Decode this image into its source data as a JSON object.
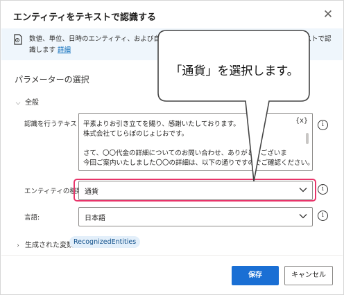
{
  "dialog": {
    "title": "エンティティをテキストで認識する",
    "close_glyph": "✕"
  },
  "info": {
    "line1": "数値、単位、日時のエンティティ、および自然言語",
    "line1_tail": "ストで認",
    "line2": "識します",
    "link": "詳細"
  },
  "params": {
    "section_title": "パラメーターの選択",
    "group_label": "全般",
    "text_label": "認識を行うテキスト:",
    "text_lines": [
      "平素よりお引き立てを賜り、感謝いたしております。",
      "株式会社てじらぼのじょじおです。",
      "",
      "さて、〇〇代金の詳細についてのお問い合わせ、ありがとうございま",
      "今回ご案内いたしました〇〇の詳細は、以下の通りですのでご確認ください。"
    ],
    "var_button": "{x}",
    "entity_label": "エンティティの種類:",
    "entity_value": "通貨",
    "language_label": "言語:",
    "language_value": "日本語",
    "help_glyph": "i"
  },
  "vars": {
    "header": "生成された変数",
    "chip": "RecognizedEntities"
  },
  "buttons": {
    "save": "保存",
    "cancel": "キャンセル"
  },
  "callout": {
    "text": "「通貨」を選択します。"
  },
  "colors": {
    "accent": "#1a6fd4",
    "highlight": "#e8356a",
    "info_bg": "#eff6fc"
  }
}
